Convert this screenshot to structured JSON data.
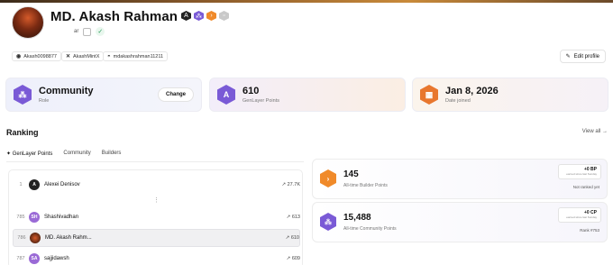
{
  "profile": {
    "name": "MD. Akash Rahman",
    "sub_text": "ar"
  },
  "socials": [
    {
      "icon": "github-icon",
      "label": "Akash0098877"
    },
    {
      "icon": "x-icon",
      "label": "AkashMintX"
    },
    {
      "icon": "discord-icon",
      "label": "mdakashrahman11211"
    }
  ],
  "edit_label": "Edit profile",
  "cards": {
    "community": {
      "title": "Community",
      "sub": "Role",
      "button": "Change"
    },
    "points": {
      "title": "610",
      "sub": "GenLayer Points"
    },
    "date": {
      "title": "Jan 8, 2026",
      "sub": "Date joined"
    }
  },
  "ranking": {
    "title": "Ranking",
    "view_all": "View all →",
    "tabs": [
      "GenLayer Points",
      "Community",
      "Builders"
    ],
    "rows": [
      {
        "rank": "1",
        "initials": "A",
        "name": "Alexei Denisov",
        "points": "27.7K",
        "color": "#222222"
      },
      {
        "rank": "785",
        "initials": "SH",
        "name": "Shashivadhan",
        "points": "613",
        "color": "#9a6ad6"
      },
      {
        "rank": "786",
        "initials": "",
        "name": "MD. Akash Rahm...",
        "points": "610",
        "color": "#7a2a12"
      },
      {
        "rank": "787",
        "initials": "SA",
        "name": "sajjidawsh",
        "points": "609",
        "color": "#9a6ad6"
      }
    ]
  },
  "builder": {
    "value": "145",
    "label": "All-time Builder Points",
    "pill": "+0 BP",
    "pill_sub": "earned since last Sunday",
    "meta": "Not ranked yet"
  },
  "communitypts": {
    "value": "15,488",
    "label": "All-time Community Points",
    "pill": "+0 CP",
    "pill_sub": "earned since last Sunday",
    "meta": "Rank #753"
  },
  "colors": {
    "builder": "#f08a2a",
    "community": "#7a5ad6",
    "points": "#7a5ad6"
  }
}
